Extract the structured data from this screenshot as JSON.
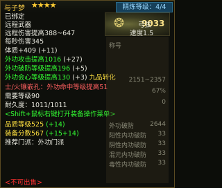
{
  "header": {
    "name": "与子梦",
    "stars": "★★★★",
    "refine_label": "精炼等级：4/4"
  },
  "item": {
    "bound": "已绑定",
    "category": "远程武器",
    "type": "弓弦",
    "stat1": "远程伤害提高388~647",
    "speed": "速度1.5",
    "stat2": "每秒伤害345",
    "vitality": "体质+409 (+11)",
    "power_value": "9033"
  },
  "lines": {
    "l1": "外功攻击提高1016",
    "l1b": "(+27)",
    "l2": "外功破防等级提高196",
    "l2b": "(+5)",
    "l3": "外功会心等级提高130",
    "l3b": "(+3)",
    "l3c": "九品转化",
    "gem1": "士/火镶嵌孔：外功命中等级提高51",
    "req_level": "需要等级90",
    "durability": "耐久度：1011/1011",
    "shift_hint": "<Shift+鼠标右键打开装备操作菜单>",
    "level_rating": "品质等级525",
    "level_rating_b": "(+14)",
    "score": "装备分数567",
    "score_b": "(+15+14)",
    "class_req": "推荐门派：外功门派",
    "unsellable": "<不可出售>"
  },
  "side_panel": {
    "rows": [
      {
        "label": "称号",
        "value": ""
      },
      {
        "label": "",
        "value": "2151~2357"
      },
      {
        "label": "",
        "value": "67%"
      },
      {
        "label": "",
        "value": "0"
      },
      {
        "label": "外功破防",
        "value": "2644"
      },
      {
        "label": "阳性内功破防",
        "value": "33"
      },
      {
        "label": "阴性内功破防",
        "value": "33"
      },
      {
        "label": "混元内功破防",
        "value": "33"
      },
      {
        "label": "毒性内功破防",
        "value": "33"
      }
    ]
  }
}
